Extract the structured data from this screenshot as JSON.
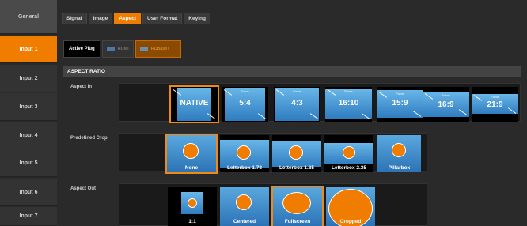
{
  "sidebar": {
    "items": [
      {
        "label": "General"
      },
      {
        "label": "Input 1"
      },
      {
        "label": "Input 2"
      },
      {
        "label": "Input 3"
      },
      {
        "label": "Input 4"
      },
      {
        "label": "Input 5"
      },
      {
        "label": "Input 6"
      },
      {
        "label": "Input 7"
      }
    ],
    "active_index": 1
  },
  "tabs": [
    {
      "label": "Signal"
    },
    {
      "label": "Image"
    },
    {
      "label": "Aspect"
    },
    {
      "label": "User Format"
    },
    {
      "label": "Keying"
    }
  ],
  "active_tab": "Aspect",
  "plug": {
    "label": "Active Plug",
    "options": [
      {
        "label": "HDMI",
        "icon": "hdmi-connector-icon"
      },
      {
        "label": "HDBaseT",
        "icon": "hdbaset-connector-icon"
      }
    ],
    "selected": "HDBaseT"
  },
  "aspect_ratio": {
    "header": "ASPECT RATIO",
    "aspect_in": {
      "label": "Aspect In",
      "selected": "NATIVE",
      "options": [
        {
          "label": "NATIVE",
          "sub": ""
        },
        {
          "label": "5:4",
          "sub": "Force"
        },
        {
          "label": "4:3",
          "sub": "Force"
        },
        {
          "label": "16:10",
          "sub": "Force"
        },
        {
          "label": "15:9",
          "sub": "Force"
        },
        {
          "label": "16:9",
          "sub": "Force"
        },
        {
          "label": "21:9",
          "sub": "Force"
        }
      ]
    },
    "predefined_crop": {
      "label": "Predefined Crop",
      "selected": "None",
      "options": [
        {
          "label": "None"
        },
        {
          "label": "Letterbox 1.78"
        },
        {
          "label": "Letterbox 1.85"
        },
        {
          "label": "Letterbox 2.35"
        },
        {
          "label": "Pillarbox"
        }
      ]
    },
    "aspect_out": {
      "label": "Aspect Out",
      "selected": "Fullscreen",
      "options": [
        {
          "label": "1:1"
        },
        {
          "label": "Centered"
        },
        {
          "label": "Fullscreen"
        },
        {
          "label": "Cropped"
        }
      ]
    }
  },
  "colors": {
    "accent": "#f07c00",
    "tile_blue": "#2c73b6"
  }
}
